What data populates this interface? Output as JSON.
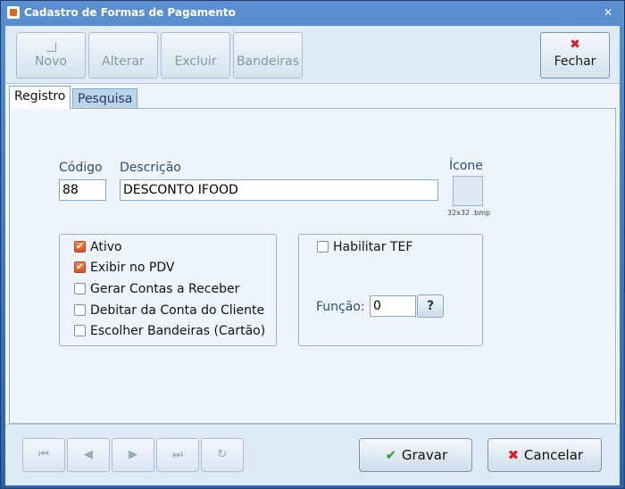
{
  "window": {
    "title": "Cadastro de Formas de Pagamento",
    "close_glyph": "✕"
  },
  "toolbar": {
    "novo": "Novo",
    "alterar": "Alterar",
    "excluir": "Excluir",
    "bandeiras": "Bandeiras",
    "fechar": "Fechar",
    "fechar_icon": "✖"
  },
  "tabs": [
    {
      "label": "Registro"
    },
    {
      "label": "Pesquisa"
    }
  ],
  "form": {
    "codigo_label": "Código",
    "codigo_value": "88",
    "descricao_label": "Descrição",
    "descricao_value": "DESCONTO IFOOD",
    "icone_label": "Ícone",
    "icone_hint": "32x32 .bmp"
  },
  "options": [
    {
      "label": "Ativo",
      "checked": true
    },
    {
      "label": "Exibir no PDV",
      "checked": true
    },
    {
      "label": "Gerar Contas a Receber",
      "checked": false
    },
    {
      "label": "Debitar da Conta do Cliente",
      "checked": false
    },
    {
      "label": "Escolher Bandeiras (Cartão)",
      "checked": false
    }
  ],
  "tef": {
    "habilitar_label": "Habilitar TEF",
    "habilitar_checked": false,
    "funcao_label": "Função:",
    "funcao_value": "0",
    "help_button": "?"
  },
  "navigation": {
    "first": "⏮",
    "prev": "◀",
    "next": "▶",
    "last": "⏭",
    "refresh": "↻"
  },
  "actions": {
    "gravar": "Gravar",
    "gravar_icon": "✔",
    "cancelar": "Cancelar",
    "cancelar_icon": "✖"
  },
  "colors": {
    "accent": "#3c6fb0",
    "check": "#e06a3a",
    "ok": "#2a9a2a",
    "cancel": "#d0202a"
  }
}
